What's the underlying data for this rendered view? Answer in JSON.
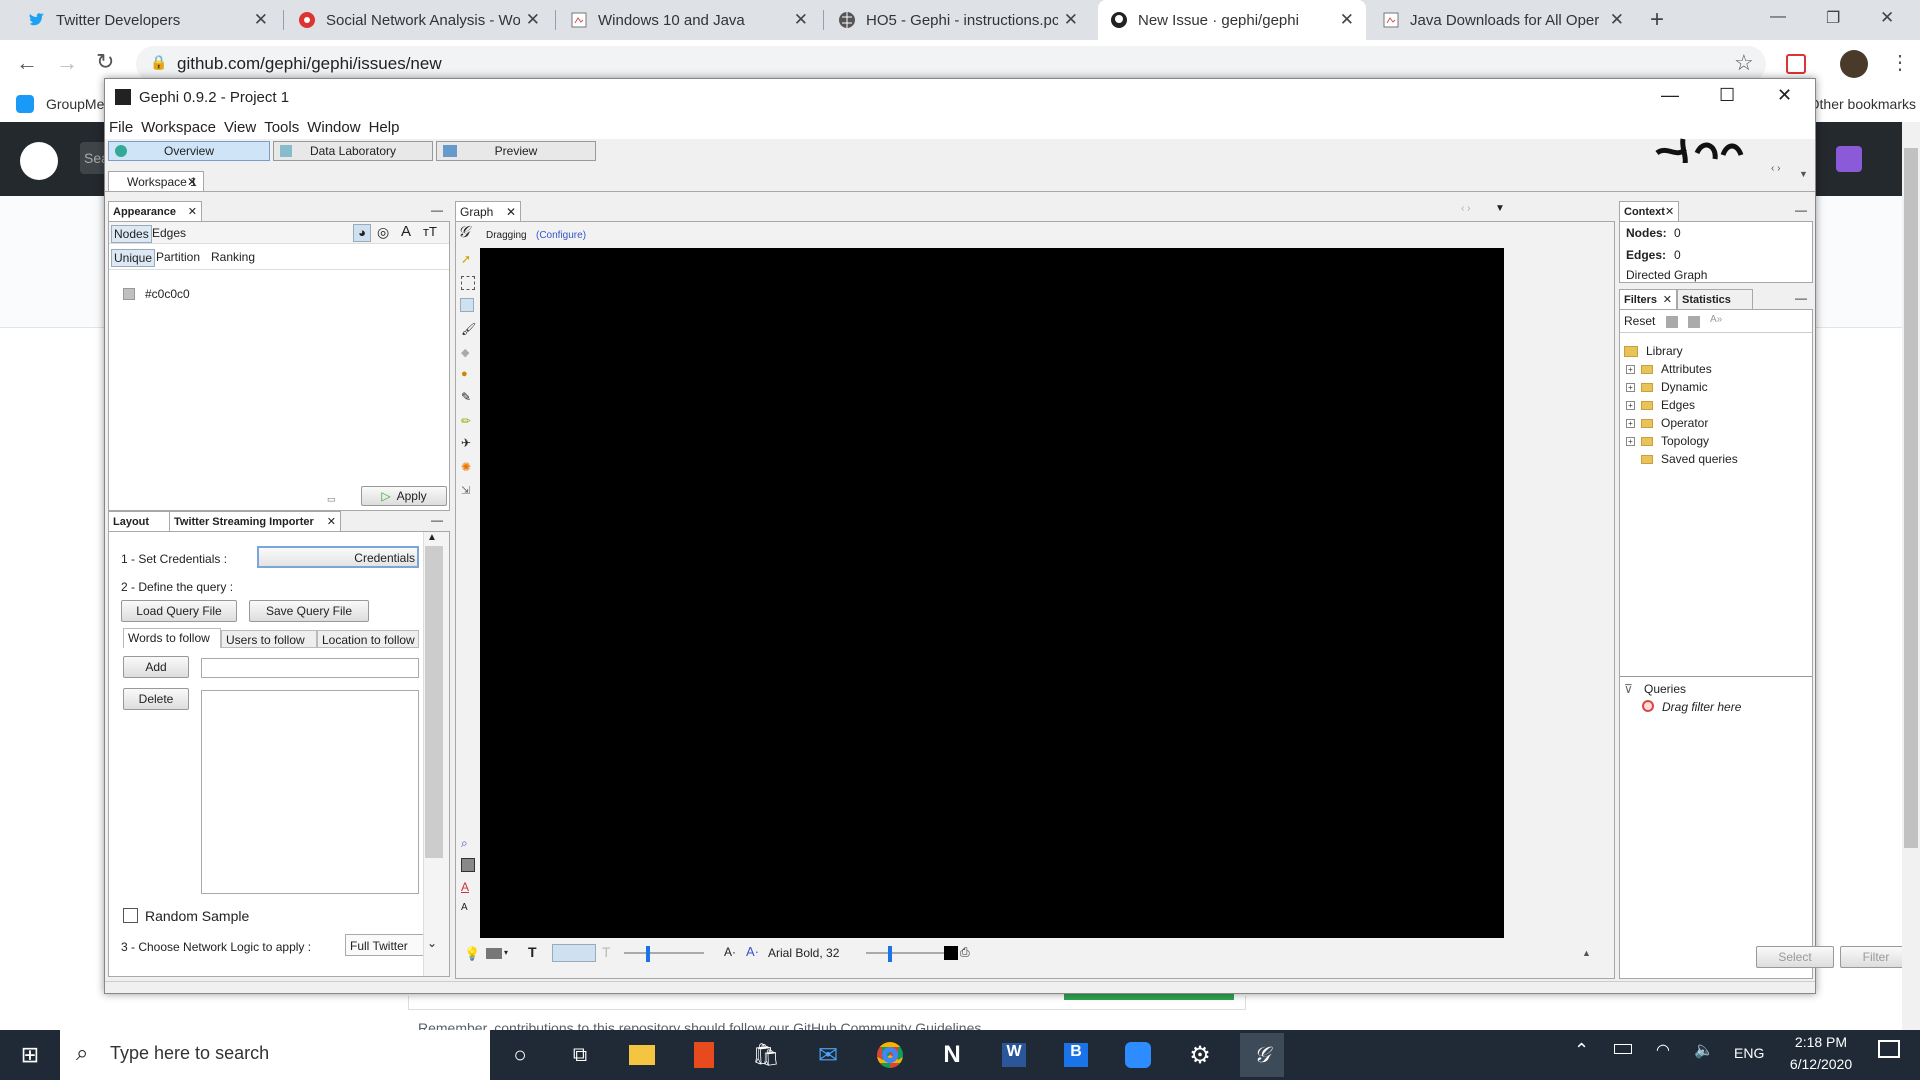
{
  "browser": {
    "tabs": [
      {
        "title": "Twitter Developers",
        "icon": "twitter-icon"
      },
      {
        "title": "Social Network Analysis - Wo",
        "icon": "red-gear-icon"
      },
      {
        "title": "Windows 10 and Java",
        "icon": "document-icon"
      },
      {
        "title": "HO5 - Gephi - instructions.pc",
        "icon": "globe-icon"
      },
      {
        "title": "New Issue · gephi/gephi",
        "icon": "github-icon"
      },
      {
        "title": "Java Downloads for All Oper",
        "icon": "document-icon"
      }
    ],
    "url": "github.com/gephi/gephi/issues/new",
    "bookmark_left": "GroupMe",
    "bookmark_right": "Other bookmarks"
  },
  "github": {
    "search_placeholder": "Search",
    "footer_note": "Remember, contributions to this repository should follow our GitHub Community Guidelines."
  },
  "gephi": {
    "title": "Gephi 0.9.2 - Project 1",
    "menu": [
      "File",
      "Workspace",
      "View",
      "Tools",
      "Window",
      "Help"
    ],
    "modes": [
      "Overview",
      "Data Laboratory",
      "Preview"
    ],
    "workspace_tab": "Workspace 1",
    "appearance": {
      "title": "Appearance",
      "subtabs": [
        "Nodes",
        "Edges"
      ],
      "modes": [
        "Unique",
        "Partition",
        "Ranking"
      ],
      "color": "#c0c0c0",
      "apply": "Apply"
    },
    "lower_tabs": [
      "Layout",
      "Twitter Streaming Importer"
    ],
    "importer": {
      "step1": "1 - Set Credentials :",
      "credentials_btn": "Credentials",
      "step2": "2 - Define the query :",
      "load": "Load Query File",
      "save": "Save Query File",
      "query_tabs": [
        "Words to follow",
        "Users to follow",
        "Location to follow"
      ],
      "add": "Add",
      "delete": "Delete",
      "random_sample": "Random Sample",
      "step3": "3 - Choose Network Logic to apply :",
      "logic": "Full Twitter"
    },
    "graph": {
      "tab": "Graph",
      "mode": "Dragging",
      "configure": "(Configure)",
      "font": "Arial Bold, 32"
    },
    "context": {
      "title": "Context",
      "nodes_label": "Nodes:",
      "nodes": "0",
      "edges_label": "Edges:",
      "edges": "0",
      "type": "Directed Graph"
    },
    "filters": {
      "tabs": [
        "Filters",
        "Statistics"
      ],
      "reset": "Reset",
      "library": "Library",
      "items": [
        "Attributes",
        "Dynamic",
        "Edges",
        "Operator",
        "Topology",
        "Saved queries"
      ],
      "queries": "Queries",
      "drag": "Drag filter here",
      "select": "Select",
      "filter": "Filter"
    }
  },
  "taskbar": {
    "search": "Type here to search",
    "lang": "ENG",
    "time": "2:18 PM",
    "date": "6/12/2020"
  }
}
